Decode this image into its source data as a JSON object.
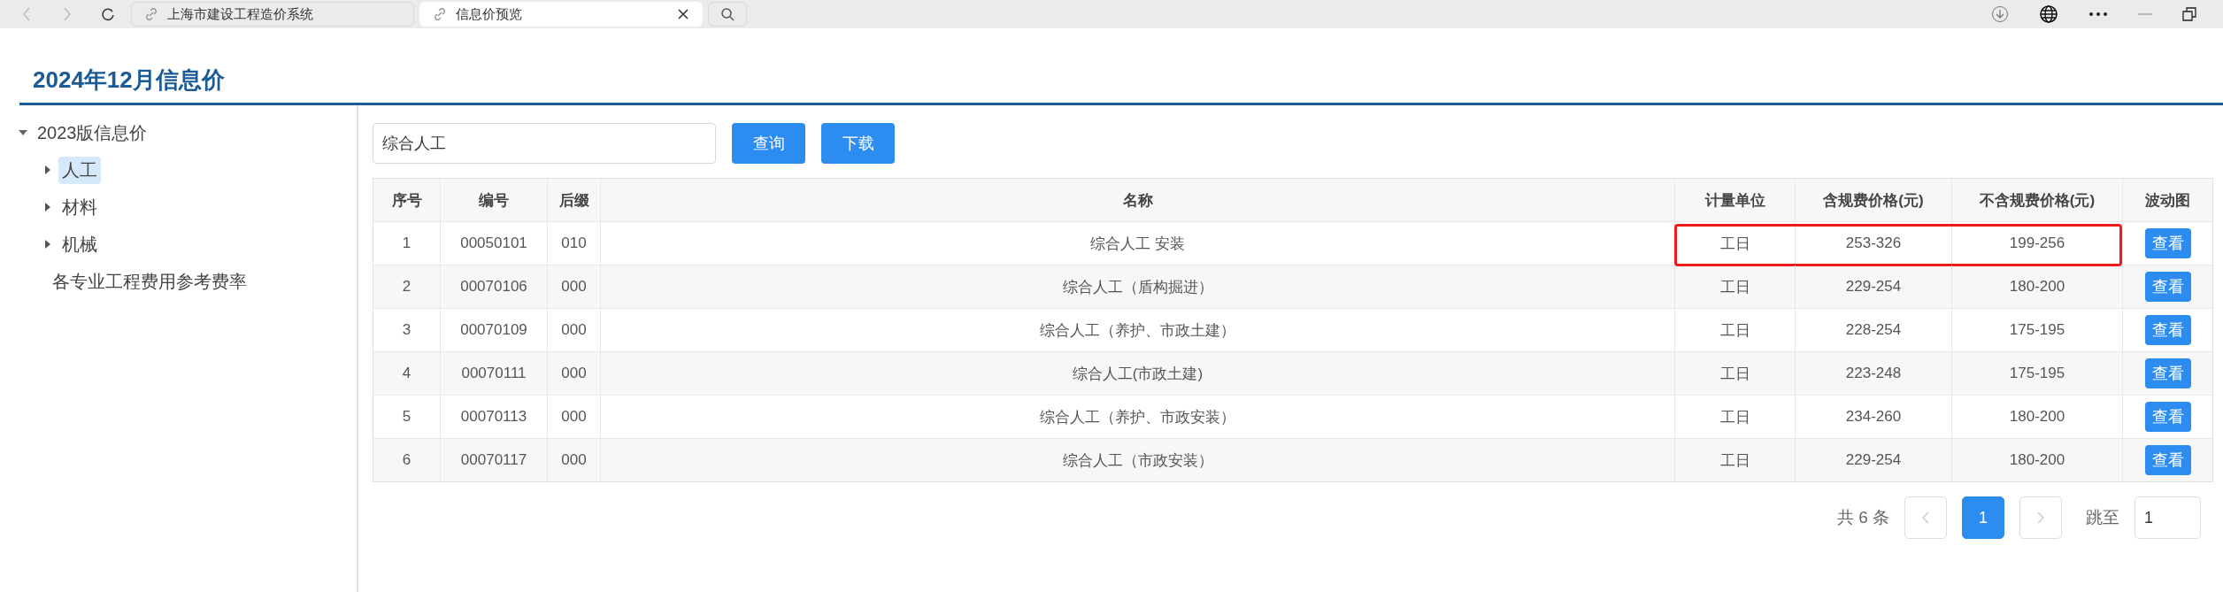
{
  "browser": {
    "tabs": [
      {
        "title": "上海市建设工程造价系统",
        "selected": false
      },
      {
        "title": "信息价预览",
        "selected": true
      }
    ]
  },
  "page_title": "2024年12月信息价",
  "tree": [
    {
      "label": "2023版信息价",
      "kind": "folder",
      "expanded": true,
      "selected": false,
      "children": [
        {
          "label": "人工",
          "kind": "folder",
          "expanded": false,
          "selected": true
        },
        {
          "label": "材料",
          "kind": "folder",
          "expanded": false,
          "selected": false
        },
        {
          "label": "机械",
          "kind": "folder",
          "expanded": false,
          "selected": false
        },
        {
          "label": "各专业工程费用参考费率",
          "kind": "leaf",
          "selected": false
        }
      ]
    }
  ],
  "search": {
    "value": "综合人工"
  },
  "buttons": [
    "查询",
    "下载"
  ],
  "table": {
    "columns": [
      "序号",
      "编号",
      "后缀",
      "名称",
      "计量单位",
      "含规费价格(元)",
      "不含规费价格(元)",
      "波动图"
    ],
    "rows": [
      {
        "cells": [
          "1",
          "00050101",
          "010",
          "综合人工 安装",
          "工日",
          "253-326",
          "199-256"
        ],
        "action": "查看",
        "highlighted": true
      },
      {
        "cells": [
          "2",
          "00070106",
          "000",
          "综合人工（盾构掘进）",
          "工日",
          "229-254",
          "180-200"
        ],
        "action": "查看",
        "highlighted": false
      },
      {
        "cells": [
          "3",
          "00070109",
          "000",
          "综合人工（养护、市政土建）",
          "工日",
          "228-254",
          "175-195"
        ],
        "action": "查看",
        "highlighted": false
      },
      {
        "cells": [
          "4",
          "00070111",
          "000",
          "综合人工(市政土建)",
          "工日",
          "223-248",
          "175-195"
        ],
        "action": "查看",
        "highlighted": false
      },
      {
        "cells": [
          "5",
          "00070113",
          "000",
          "综合人工（养护、市政安装）",
          "工日",
          "234-260",
          "180-200"
        ],
        "action": "查看",
        "highlighted": false
      },
      {
        "cells": [
          "6",
          "00070117",
          "000",
          "综合人工（市政安装）",
          "工日",
          "229-254",
          "180-200"
        ],
        "action": "查看",
        "highlighted": false
      }
    ]
  },
  "pagination": {
    "total": "共 6 条",
    "pages": [
      {
        "label": "1",
        "selected": true
      }
    ],
    "jump_label": "跳至",
    "jump_value": "1"
  }
}
